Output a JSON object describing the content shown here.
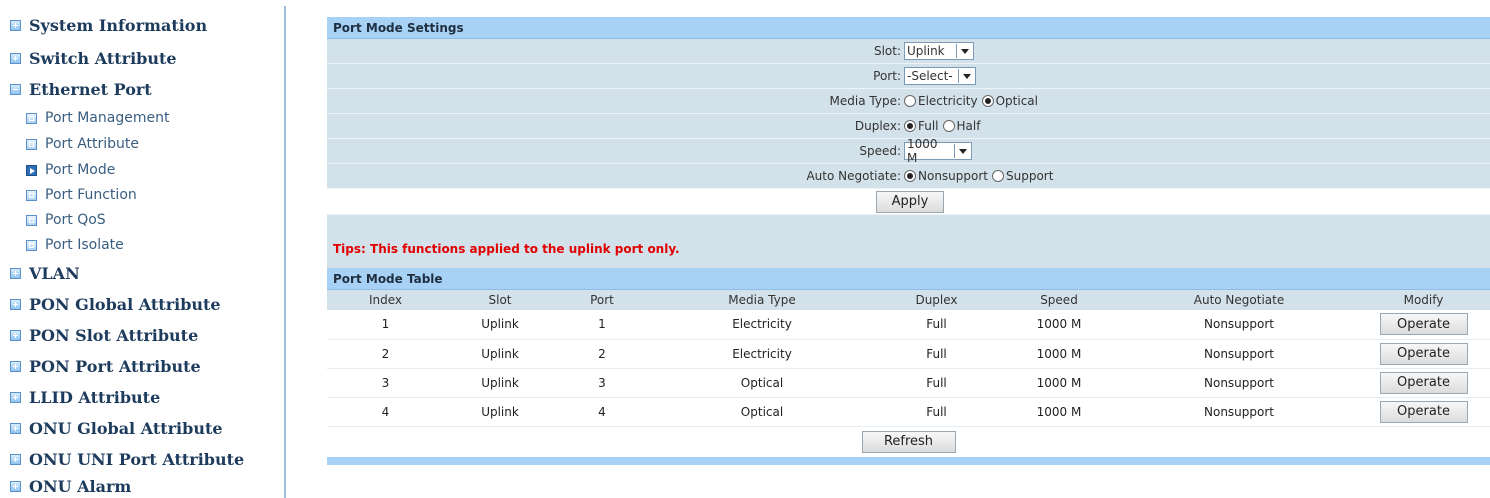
{
  "sidebar": {
    "items": [
      {
        "label": "System Information"
      },
      {
        "label": "Switch Attribute"
      },
      {
        "label": "Ethernet Port"
      },
      {
        "label": "Port Management"
      },
      {
        "label": "Port Attribute"
      },
      {
        "label": "Port Mode"
      },
      {
        "label": "Port Function"
      },
      {
        "label": "Port QoS"
      },
      {
        "label": "Port Isolate"
      },
      {
        "label": "VLAN"
      },
      {
        "label": "PON Global Attribute"
      },
      {
        "label": "PON Slot Attribute"
      },
      {
        "label": "PON Port Attribute"
      },
      {
        "label": "LLID Attribute"
      },
      {
        "label": "ONU Global Attribute"
      },
      {
        "label": "ONU UNI Port Attribute"
      },
      {
        "label": "ONU Alarm"
      }
    ]
  },
  "settings": {
    "title": "Port Mode Settings",
    "slot_label": "Slot:",
    "slot_value": "Uplink",
    "port_label": "Port:",
    "port_value": "-Select-",
    "media_label": "Media Type:",
    "media_opt1": "Electricity",
    "media_opt2": "Optical",
    "duplex_label": "Duplex:",
    "duplex_opt1": "Full",
    "duplex_opt2": "Half",
    "speed_label": "Speed:",
    "speed_value": "1000 M",
    "auto_label": "Auto Negotiate:",
    "auto_opt1": "Nonsupport",
    "auto_opt2": "Support",
    "apply_label": "Apply"
  },
  "tips": "Tips: This functions applied to the uplink port only.",
  "table": {
    "title": "Port Mode Table",
    "headers": [
      "Index",
      "Slot",
      "Port",
      "Media Type",
      "Duplex",
      "Speed",
      "Auto Negotiate",
      "Modify"
    ],
    "rows": [
      {
        "index": "1",
        "slot": "Uplink",
        "port": "1",
        "media": "Electricity",
        "duplex": "Full",
        "speed": "1000 M",
        "auto": "Nonsupport",
        "action": "Operate"
      },
      {
        "index": "2",
        "slot": "Uplink",
        "port": "2",
        "media": "Electricity",
        "duplex": "Full",
        "speed": "1000 M",
        "auto": "Nonsupport",
        "action": "Operate"
      },
      {
        "index": "3",
        "slot": "Uplink",
        "port": "3",
        "media": "Optical",
        "duplex": "Full",
        "speed": "1000 M",
        "auto": "Nonsupport",
        "action": "Operate"
      },
      {
        "index": "4",
        "slot": "Uplink",
        "port": "4",
        "media": "Optical",
        "duplex": "Full",
        "speed": "1000 M",
        "auto": "Nonsupport",
        "action": "Operate"
      }
    ],
    "refresh_label": "Refresh"
  }
}
